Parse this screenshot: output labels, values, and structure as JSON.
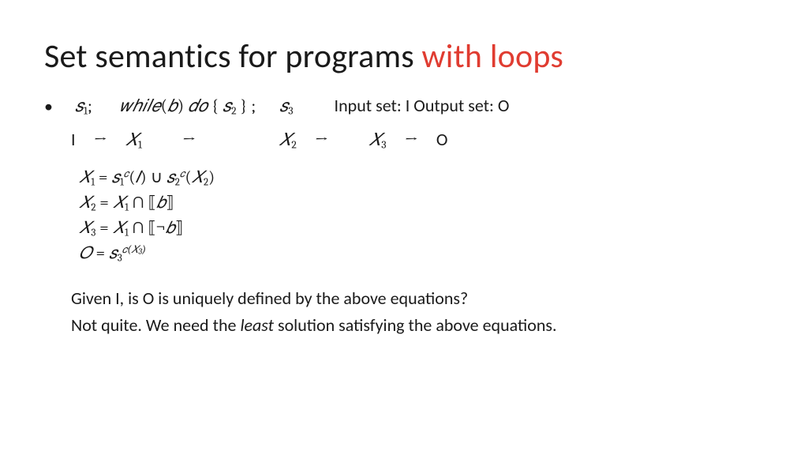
{
  "title": {
    "plain": "Set semantics for programs ",
    "em": "with loops"
  },
  "program": {
    "s1": "𝑠",
    "s1sub": "1",
    "semi1": ";",
    "while_kw": "𝑤ℎ𝑖𝑙𝑒",
    "lpar": "(",
    "b": "𝑏",
    "rpar": ")",
    "do_kw": " 𝑑𝑜 ",
    "lbrace": "{  ",
    "s2": "𝑠",
    "s2sub": "2",
    "rbrace": "   } ;",
    "s3": "𝑠",
    "s3sub": "3",
    "io_text": "Input set: I  Output set: O"
  },
  "flow": {
    "I": "I",
    "arr": "→",
    "X1": "𝑋",
    "X1sub": "1",
    "X2": "𝑋",
    "X2sub": "2",
    "X3": "𝑋",
    "X3sub": "3",
    "O": "O"
  },
  "eqs": {
    "l1_a": "𝑋",
    "l1_asub": "1",
    "l1_eq": " = ",
    "l1_b": "𝑠",
    "l1_bsub": "1",
    "l1_bsup": "𝑐",
    "l1_of1a": "(",
    "l1_I": "𝐼",
    "l1_of1b": ")",
    "l1_cup": " ∪ ",
    "l1_c": "𝑠",
    "l1_csub": "2",
    "l1_csup": "𝑐",
    "l1_of2a": "(",
    "l1_X2": "𝑋",
    "l1_X2sub": "2",
    "l1_of2b": ")",
    "l2_a": "𝑋",
    "l2_asub": "2",
    "l2_eq": " = ",
    "l2_b": "𝑋",
    "l2_bsub": "1",
    "l2_cap": " ∩ ",
    "l2_ld": "⟦",
    "l2_bvar": "𝑏",
    "l2_rd": "⟧",
    "l3_a": "𝑋",
    "l3_asub": "3",
    "l3_eq": " = ",
    "l3_b": "𝑋",
    "l3_bsub": "1",
    "l3_cap": " ∩ ",
    "l3_ld": "⟦",
    "l3_neg": "¬",
    "l3_bvar": "𝑏",
    "l3_rd": "⟧",
    "l4_a": "𝑂",
    "l4_eq": " = ",
    "l4_b": "𝑠",
    "l4_bsub": "3",
    "l4_bsup_a": "𝑐(",
    "l4_bsup_X": "𝑋",
    "l4_bsup_Xsub": "3",
    "l4_bsup_b": ")"
  },
  "q1": "Given I, is O is uniquely defined by the above equations?",
  "q2_a": "Not quite. We need the ",
  "q2_em": "least",
  "q2_b": " solution satisfying the above equations."
}
